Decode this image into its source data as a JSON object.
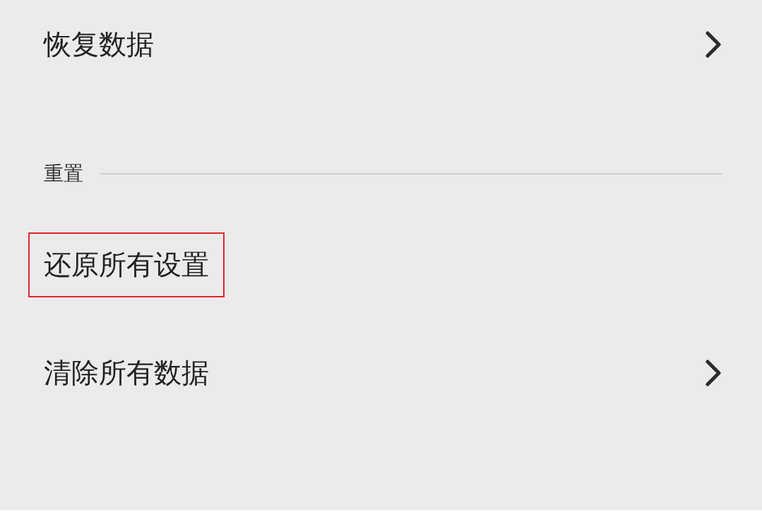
{
  "groups": [
    {
      "items": [
        {
          "label": "恢复数据",
          "kind": "nav",
          "highlighted": false
        }
      ]
    },
    {
      "header": "重置",
      "items": [
        {
          "label": "还原所有设置",
          "kind": "action",
          "highlighted": true
        },
        {
          "label": "清除所有数据",
          "kind": "nav",
          "highlighted": false
        }
      ]
    }
  ]
}
